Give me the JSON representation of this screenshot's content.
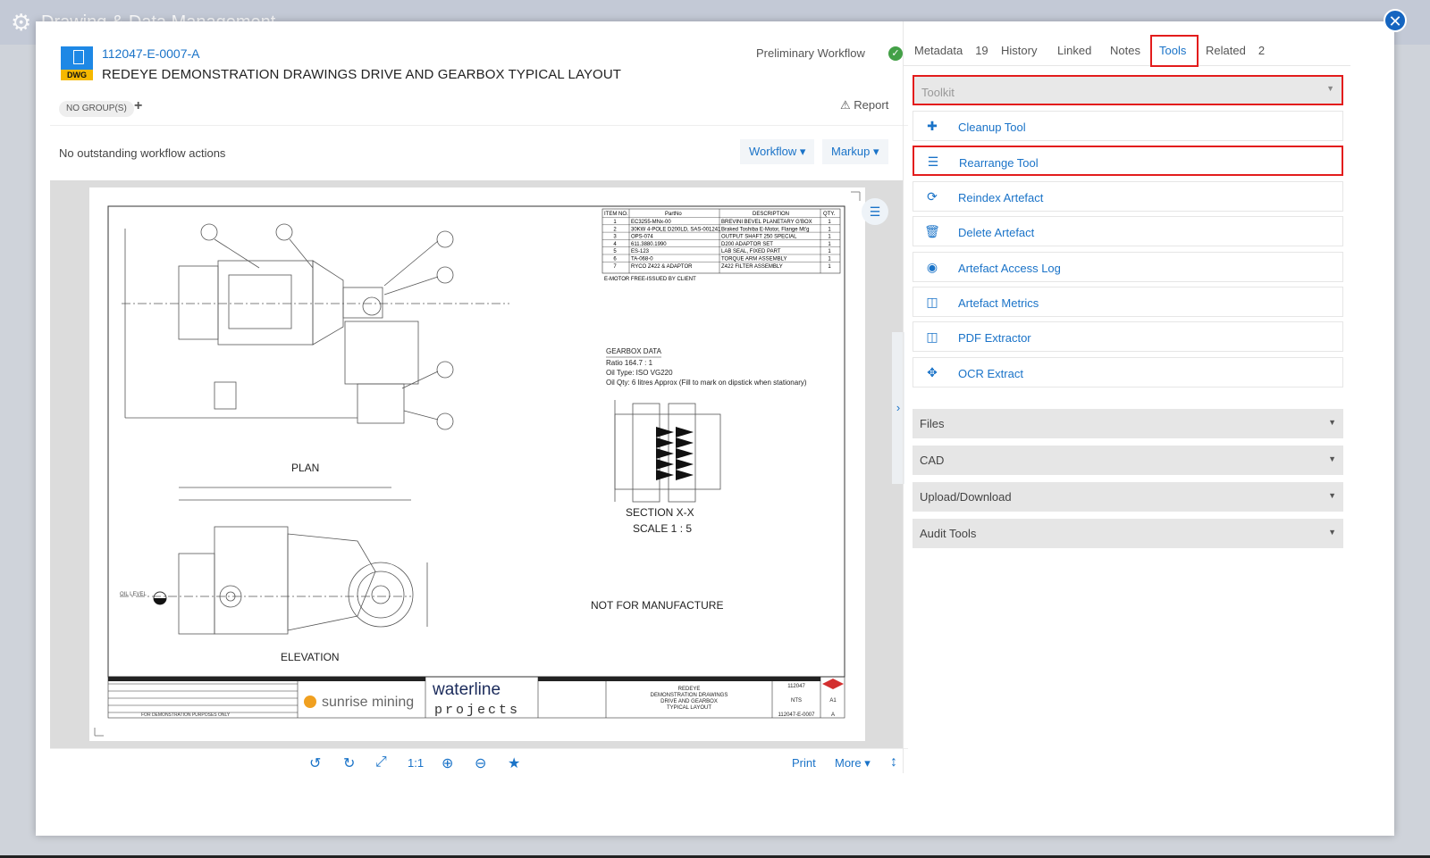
{
  "background": {
    "app_title": "Drawing & Data Management"
  },
  "document": {
    "file_type": "DWG",
    "id": "112047-E-0007-A",
    "title": "REDEYE DEMONSTRATION DRAWINGS DRIVE AND GEARBOX TYPICAL LAYOUT",
    "workflow_status": "Preliminary Workflow",
    "groups_badge": "NO GROUP(S)",
    "add_group": "+",
    "report_label": "Report",
    "actions_text": "No outstanding workflow actions",
    "workflow_btn": "Workflow ▾",
    "markup_btn": "Markup ▾"
  },
  "drawing": {
    "parts_header": [
      "ITEM NO.",
      "PartNo",
      "DESCRIPTION",
      "QTY."
    ],
    "parts": [
      [
        "1",
        "EC3255-MNx-00",
        "BREVINI BEVEL PLANETARY G'BOX",
        "1"
      ],
      [
        "2",
        "30KW 4-POLE D200LD, SAS-001241",
        "Braked Toshiba E-Motor, Flange Mt'g",
        "1"
      ],
      [
        "3",
        "OPS-074",
        "OUTPUT SHAFT 250 SPECIAL",
        "1"
      ],
      [
        "4",
        "611.3880.1990",
        "D200 ADAPTOR SET",
        "1"
      ],
      [
        "5",
        "ES-123",
        "LAB SEAL, FIXED PART",
        "1"
      ],
      [
        "6",
        "TA-068-0",
        "TORQUE ARM ASSEMBLY",
        "1"
      ],
      [
        "7",
        "RYCO Z422 & ADAPTOR",
        "Z422 FILTER ASSEMBLY",
        "1"
      ]
    ],
    "motor_note": "E-MOTOR FREE-ISSUED BY CLIENT",
    "gearbox_title": "GEARBOX DATA",
    "gearbox_ratio": "Ratio 164.7 : 1",
    "gearbox_oil_type": "Oil Type: ISO VG220",
    "gearbox_oil_qty": "Oil Qty: 6 litres Approx (Fill to mark on dipstick when stationary)",
    "plan_label": "PLAN",
    "elevation_label": "ELEVATION",
    "section_label": "SECTION X-X",
    "scale_label": "SCALE 1 : 5",
    "not_for_manufacture": "NOT FOR MANUFACTURE",
    "client_logo": "sunrise mining",
    "company_logo_top": "waterline",
    "company_logo_bottom": "projects",
    "title_block": [
      "REDEYE",
      "DEMONSTRATION DRAWINGS",
      "DRIVE AND GEARBOX",
      "TYPICAL LAYOUT"
    ],
    "demo_note": "FOR DEMONSTRATION PURPOSES ONLY",
    "drawing_no": "112047-E-0007",
    "rev": "A",
    "sheet_size": "A1",
    "job_code": "112047",
    "scale_value": "NTS",
    "oil_level": "OIL LEVEL"
  },
  "viewer_toolbar": {
    "ratio": "1:1",
    "print": "Print",
    "more": "More ▾"
  },
  "tabs": [
    {
      "label": "Metadata",
      "count": "19"
    },
    {
      "label": "History",
      "count": ""
    },
    {
      "label": "Linked",
      "count": ""
    },
    {
      "label": "Notes",
      "count": ""
    },
    {
      "label": "Tools",
      "count": ""
    },
    {
      "label": "Related",
      "count": "2"
    }
  ],
  "toolkit_placeholder": "Toolkit",
  "tools": [
    {
      "label": "Cleanup Tool",
      "icon": "puzzle-icon"
    },
    {
      "label": "Rearrange Tool",
      "icon": "list-icon"
    },
    {
      "label": "Reindex Artefact",
      "icon": "refresh-icon"
    },
    {
      "label": "Delete Artefact",
      "icon": "trash-icon"
    },
    {
      "label": "Artefact Access Log",
      "icon": "eye-icon"
    },
    {
      "label": "Artefact Metrics",
      "icon": "columns-icon"
    },
    {
      "label": "PDF Extractor",
      "icon": "columns-icon"
    },
    {
      "label": "OCR Extract",
      "icon": "crosshair-icon"
    }
  ],
  "accordions": [
    "Files",
    "CAD",
    "Upload/Download",
    "Audit Tools"
  ],
  "colors": {
    "accent": "#1a73c8",
    "highlight": "#e31c1c",
    "success": "#43a047"
  }
}
